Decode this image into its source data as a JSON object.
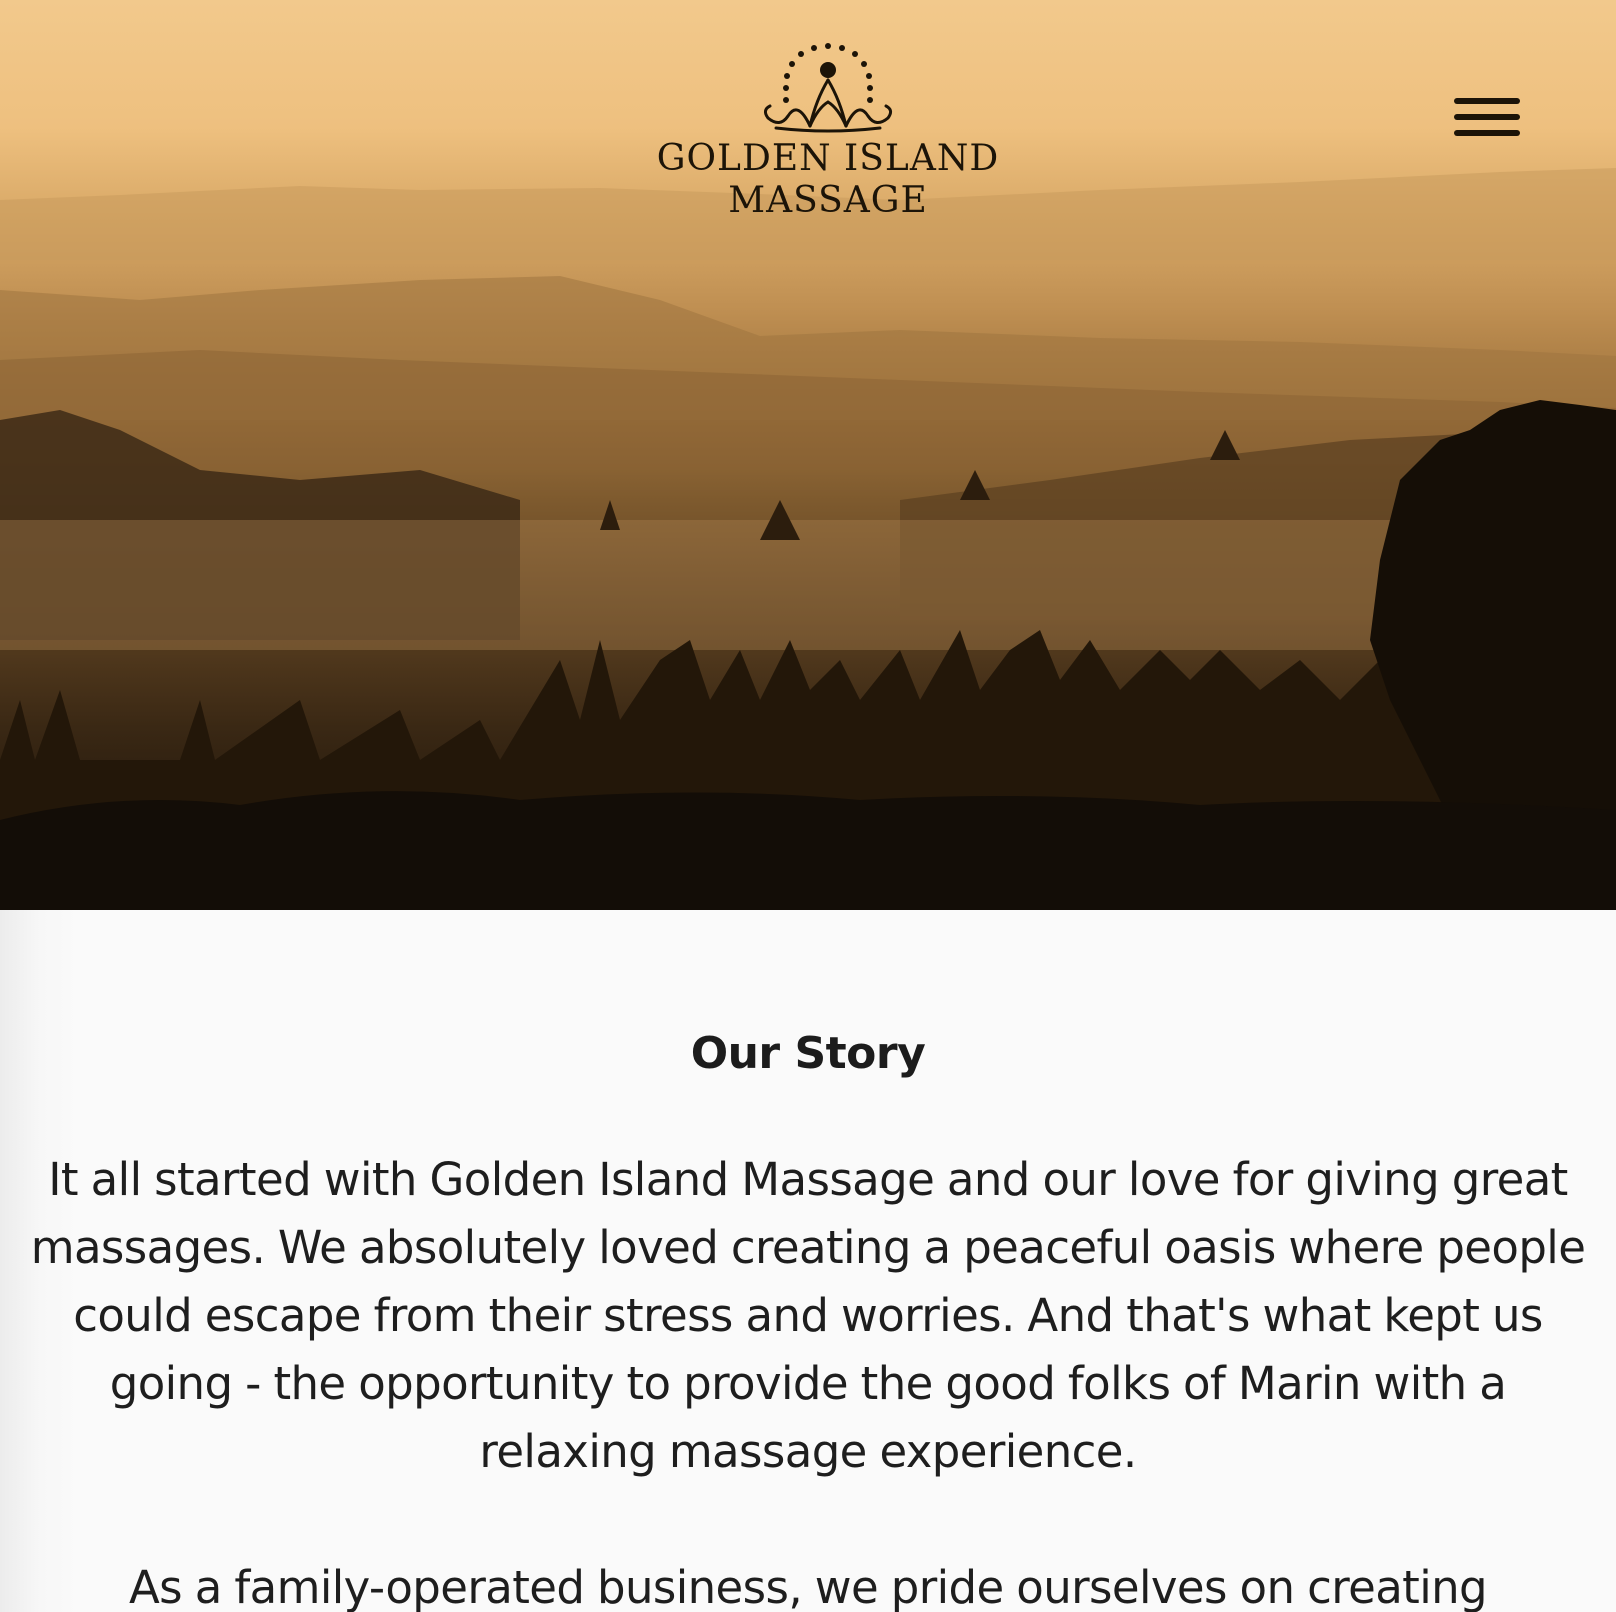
{
  "brand": {
    "line1": "GOLDEN ISLAND",
    "line2": "MASSAGE"
  },
  "header": {
    "menu_icon": "hamburger-menu-icon"
  },
  "story": {
    "title": "Our Story",
    "paragraph1": "It all started with Golden Island Massage and our love for giving great massages. We absolutely loved creating a peaceful oasis where people could escape from their stress and worries. And that's what kept us going - the opportunity to provide the good folks of Marin with a relaxing massage experience.",
    "paragraph2": "As a family-operated business, we pride ourselves on creating"
  },
  "colors": {
    "hero_sky": "#f2c98c",
    "logo_ink": "#1c1408",
    "text": "#1e1e1e",
    "background": "#fafafa"
  }
}
